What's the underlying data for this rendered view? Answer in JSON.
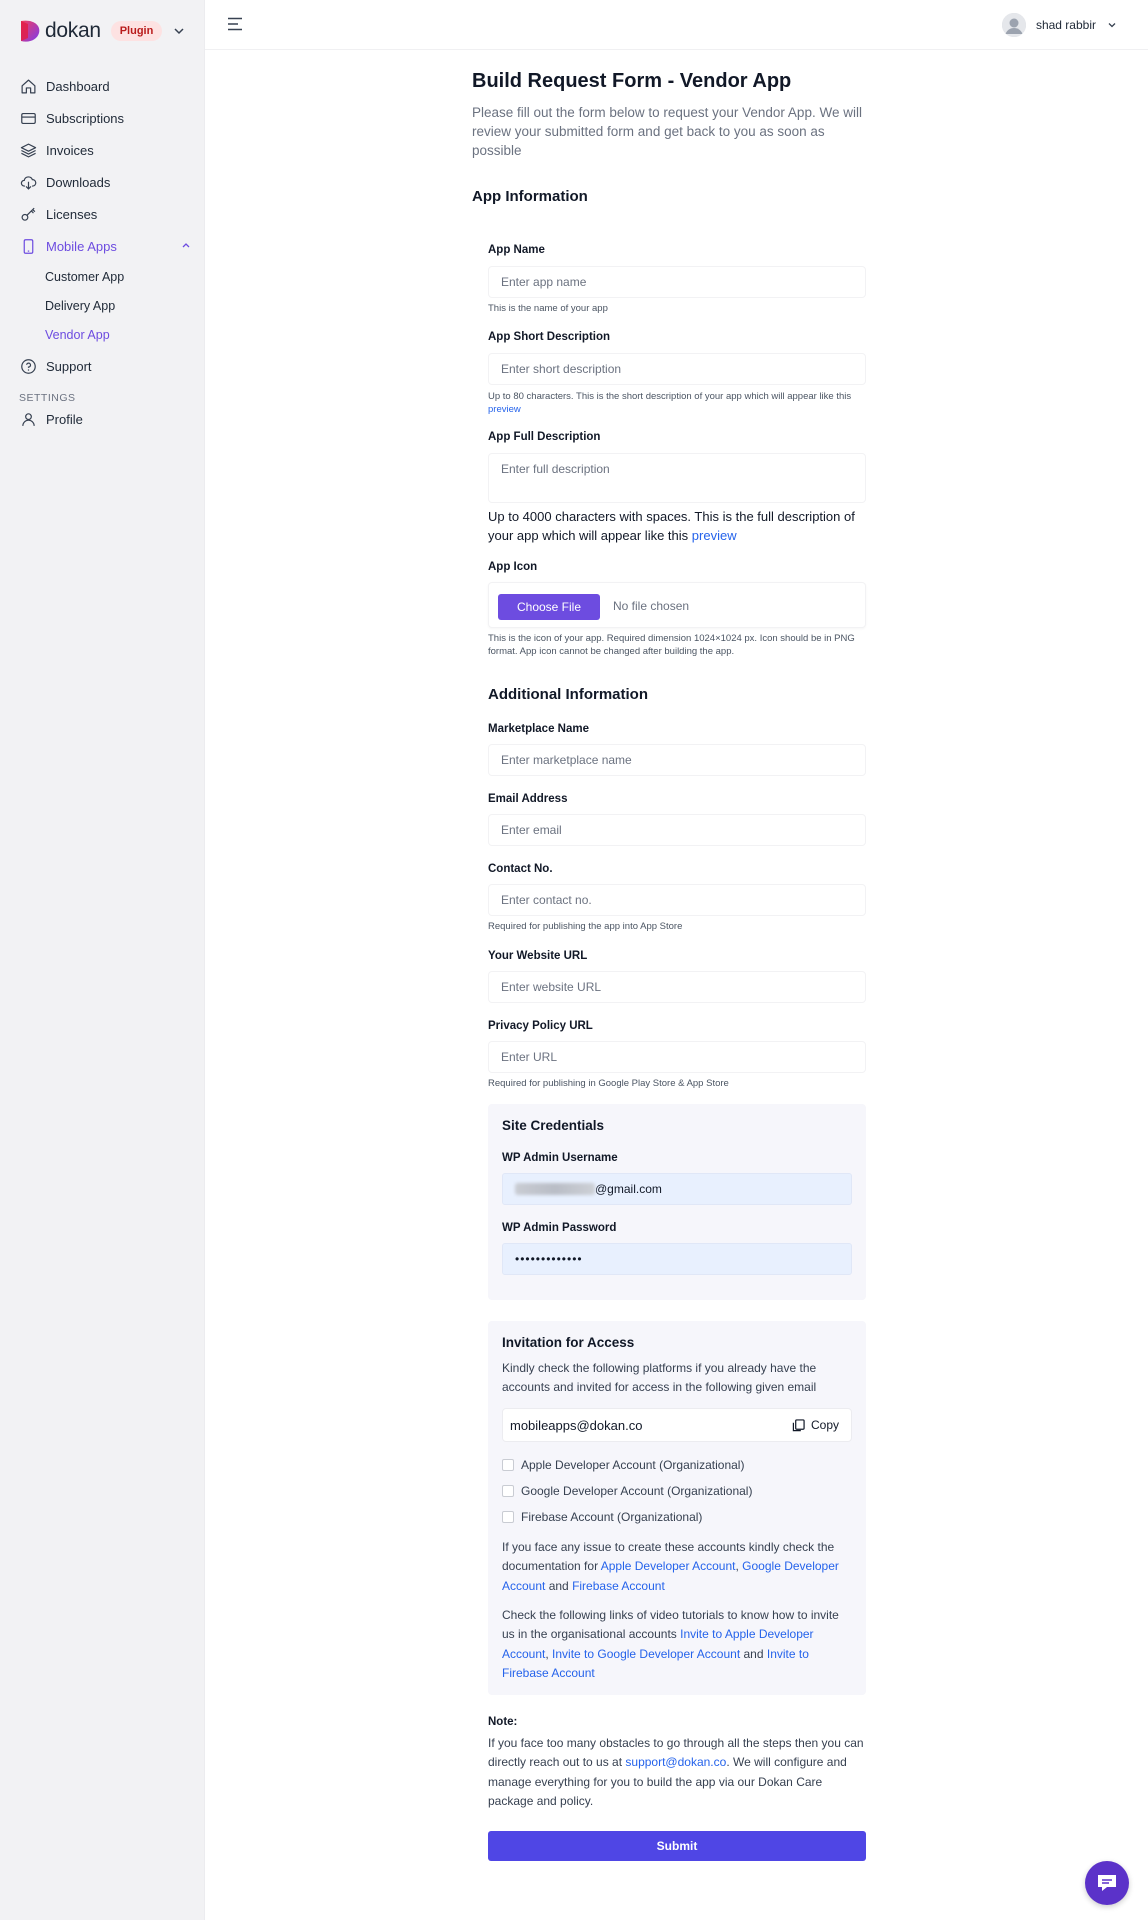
{
  "brand": {
    "name": "dokan",
    "badge": "Plugin"
  },
  "sidebar": {
    "items": [
      {
        "label": "Dashboard",
        "icon": "home-icon"
      },
      {
        "label": "Subscriptions",
        "icon": "credit-card-icon"
      },
      {
        "label": "Invoices",
        "icon": "layers-icon"
      },
      {
        "label": "Downloads",
        "icon": "cloud-download-icon"
      },
      {
        "label": "Licenses",
        "icon": "key-icon"
      },
      {
        "label": "Mobile Apps",
        "icon": "phone-icon",
        "active": true
      },
      {
        "label": "Support",
        "icon": "help-circle-icon"
      },
      {
        "label": "Profile",
        "icon": "user-icon"
      }
    ],
    "sub_items": [
      {
        "label": "Customer App"
      },
      {
        "label": "Delivery App"
      },
      {
        "label": "Vendor App",
        "active": true
      }
    ],
    "settings_label": "SETTINGS"
  },
  "header": {
    "user_name": "shad rabbir"
  },
  "page": {
    "title": "Build Request Form - Vendor App",
    "description": "Please fill out the form below to request your Vendor App. We will review your submitted form and get back to you as soon as possible"
  },
  "app_info": {
    "section_title": "App Information",
    "app_name": {
      "label": "App Name",
      "placeholder": "Enter app name",
      "hint": "This is the name of your app"
    },
    "short_desc": {
      "label": "App Short Description",
      "placeholder": "Enter short description",
      "hint": "Up to 80 characters. This is the short description of your app which will appear like this ",
      "hint_link": "preview"
    },
    "full_desc": {
      "label": "App Full Description",
      "placeholder": "Enter full description",
      "hint": "Up to 4000 characters with spaces. This is the full description of your app which will appear like this ",
      "hint_link": "preview"
    },
    "icon": {
      "label": "App Icon",
      "button": "Choose File",
      "status": "No file chosen",
      "hint": "This is the icon of your app. Required dimension 1024×1024 px. Icon should be in PNG format. App icon cannot be changed after building the app."
    }
  },
  "additional": {
    "section_title": "Additional Information",
    "marketplace": {
      "label": "Marketplace Name",
      "placeholder": "Enter marketplace name"
    },
    "email": {
      "label": "Email Address",
      "placeholder": "Enter email"
    },
    "contact": {
      "label": "Contact No.",
      "placeholder": "Enter contact no.",
      "hint": "Required for publishing the app into App Store"
    },
    "website": {
      "label": "Your Website URL",
      "placeholder": "Enter website URL"
    },
    "privacy": {
      "label": "Privacy Policy URL",
      "placeholder": "Enter URL",
      "hint": "Required for publishing in Google Play Store & App Store"
    }
  },
  "credentials": {
    "title": "Site Credentials",
    "username_label": "WP Admin Username",
    "username_visible": "@gmail.com",
    "password_label": "WP Admin Password",
    "password_value": "•••••••••••••"
  },
  "invitation": {
    "title": "Invitation for Access",
    "description": "Kindly check the following platforms if you already have the accounts and invited for access in the following given email",
    "email": "mobileapps@dokan.co",
    "copy_label": "Copy",
    "checkboxes": [
      "Apple Developer Account (Organizational)",
      "Google Developer Account (Organizational)",
      "Firebase Account (Organizational)"
    ],
    "docs_prefix": "If you face any issue to create these accounts kindly check the documentation for ",
    "docs_link1": "Apple Developer Account",
    "docs_sep1": ", ",
    "docs_link2": "Google Developer Account",
    "docs_sep2": " and ",
    "docs_link3": "Firebase Account",
    "video_prefix": "Check the following links of video tutorials to know how to invite us in the organisational accounts ",
    "video_link1": "Invite to Apple Developer Account",
    "video_sep1": ", ",
    "video_link2": "Invite to Google Developer Account",
    "video_sep2": " and ",
    "video_link3": "Invite to Firebase Account"
  },
  "note": {
    "title": "Note:",
    "prefix": "If you face too many obstacles to go through all the steps then you can directly reach out to us at ",
    "email_link": "support@dokan.co",
    "suffix": ". We will configure and manage everything for you to build the app via our Dokan Care package and policy."
  },
  "submit_label": "Submit",
  "colors": {
    "accent": "#6d4ce0",
    "submit": "#4f46e5",
    "link": "#2563eb",
    "badge_bg": "#fde2e2",
    "badge_text": "#b91c1c"
  }
}
